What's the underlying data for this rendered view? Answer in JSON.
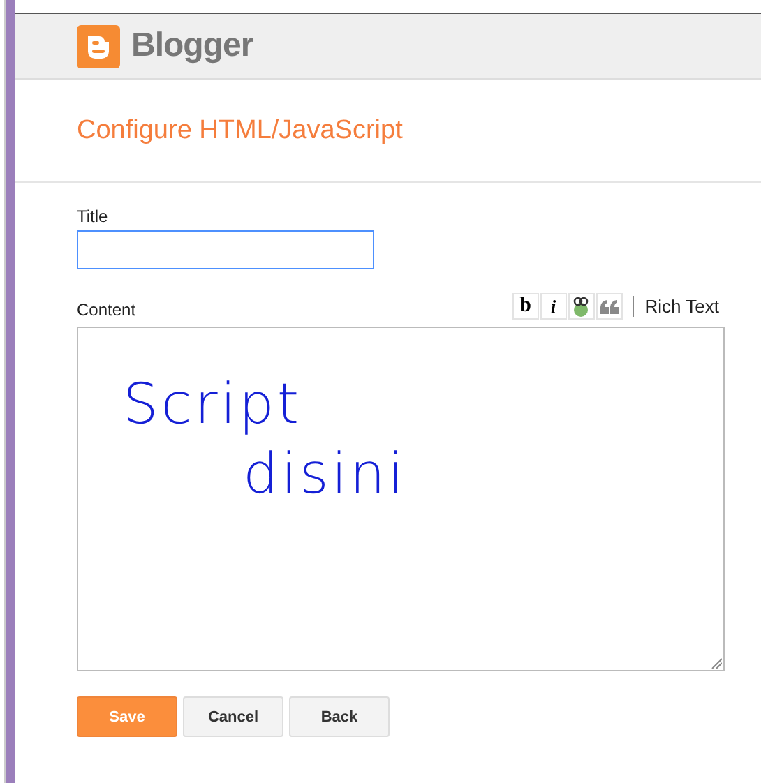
{
  "header": {
    "brand": "Blogger"
  },
  "page_title": "Configure HTML/JavaScript",
  "title_field": {
    "label": "Title",
    "focused": true
  },
  "content": {
    "label": "Content",
    "toolbar": [
      {
        "kind": "text",
        "label": "b"
      },
      {
        "kind": "text",
        "label": "i"
      },
      {
        "kind": "link"
      },
      {
        "kind": "quote"
      }
    ],
    "mode_link": "Rich Text"
  },
  "annotation": [
    "Script",
    "disini"
  ],
  "buttons": [
    {
      "label": "Save",
      "kind": "primary"
    },
    {
      "label": "Cancel",
      "kind": "secondary"
    },
    {
      "label": "Back",
      "kind": "secondary"
    }
  ]
}
